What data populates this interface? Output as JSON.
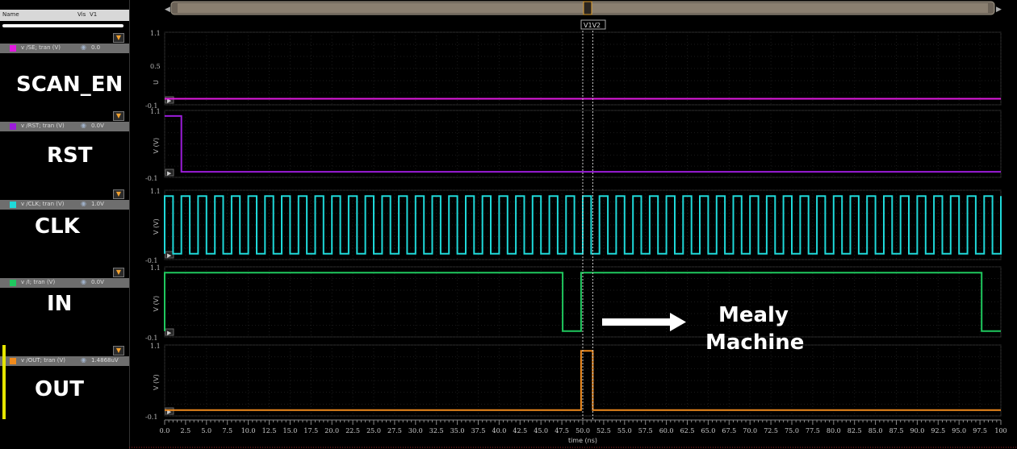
{
  "header": {
    "col_name": "Name",
    "col_vis": "Vis",
    "col_v1": "V1"
  },
  "signals": [
    {
      "name": "v /SE; tran (V)",
      "value": "0.0",
      "color": "#e21ae0",
      "label": "SCAN_EN"
    },
    {
      "name": "v /RST; tran (V)",
      "value": "0.0V",
      "color": "#9b1cd9",
      "label": "RST"
    },
    {
      "name": "v /CLK; tran (V)",
      "value": "1.0V",
      "color": "#1fd9d9",
      "label": "CLK"
    },
    {
      "name": "v /I; tran (V)",
      "value": "0.0V",
      "color": "#1fc85e",
      "label": "IN"
    },
    {
      "name": "v /OUT; tran (V)",
      "value": "1.4868uV",
      "color": "#f08a1c",
      "label": "OUT"
    }
  ],
  "plot": {
    "y_top_tick": "1.1",
    "y_mid_tick": "0.5",
    "y_bottom_tick": "-0.1",
    "y_axis_first": "U",
    "y_axis_label": "V (V)",
    "x_axis_label": "time (ns)",
    "x_ticks": [
      "0.0",
      "2.5",
      "5.0",
      "7.5",
      "10.0",
      "12.5",
      "15.0",
      "17.5",
      "20.0",
      "22.5",
      "25.0",
      "27.5",
      "30.0",
      "32.5",
      "35.0",
      "37.5",
      "40.0",
      "42.5",
      "45.0",
      "47.5",
      "50.0",
      "52.5",
      "55.0",
      "57.5",
      "60.0",
      "62.5",
      "65.0",
      "67.5",
      "70.0",
      "72.5",
      "75.0",
      "77.5",
      "80.0",
      "82.5",
      "85.0",
      "87.5",
      "90.0",
      "92.5",
      "95.0",
      "97.5",
      "100"
    ],
    "cursor_label": "V1V2",
    "x_min": 0,
    "x_max": 100,
    "v1_time": 50.0,
    "v2_time": 51.2
  },
  "waveforms": {
    "se": [
      [
        0,
        0.0
      ],
      [
        100,
        0.0
      ]
    ],
    "rst": [
      [
        0,
        1.0
      ],
      [
        2,
        1.0
      ],
      [
        2,
        0.0
      ],
      [
        100,
        0.0
      ]
    ],
    "clk_period": 2.0,
    "in": [
      [
        0,
        0.0
      ],
      [
        0,
        1.0
      ],
      [
        47.6,
        1.0
      ],
      [
        47.6,
        0.0
      ],
      [
        49.8,
        0.0
      ],
      [
        49.8,
        1.0
      ],
      [
        97.7,
        1.0
      ],
      [
        97.7,
        0.0
      ],
      [
        100,
        0.0
      ]
    ],
    "out": [
      [
        0,
        0.0
      ],
      [
        49.8,
        0.0
      ],
      [
        49.8,
        1.0
      ],
      [
        51.2,
        1.0
      ],
      [
        51.2,
        0.0
      ],
      [
        100,
        0.0
      ]
    ]
  },
  "annotation": {
    "line1": "Mealy",
    "line2": "Machine"
  }
}
